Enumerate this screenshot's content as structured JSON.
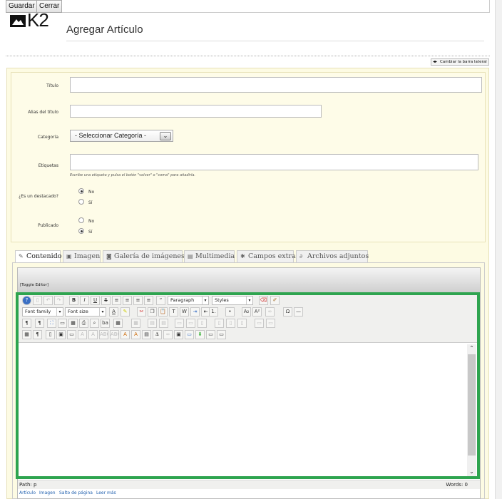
{
  "toolbar": {
    "save_label": "Guardar",
    "close_label": "Cerrar"
  },
  "header": {
    "logo_text": "K2",
    "title": "Agregar Artículo",
    "sidebar_toggle_label": "Cambiar la barra lateral"
  },
  "form": {
    "title_label": "Título",
    "alias_label": "Alias del título",
    "category_label": "Categoría",
    "category_value": "- Seleccionar Categoría -",
    "tags_label": "Etiquetas",
    "tags_hint": "Escribe una etiqueta y pulsa el botón \"volver\" o \"coma\" para añadirla.",
    "featured_label": "¿Es un destacado?",
    "published_label": "Publicado",
    "no_label": "No",
    "yes_label": "Sí",
    "featured_value": "No",
    "published_value": "Sí"
  },
  "tabs": [
    {
      "label": "Contenido",
      "icon": "pencil-icon",
      "active": true
    },
    {
      "label": "Imagen",
      "icon": "image-icon"
    },
    {
      "label": "Galería de imágenes",
      "icon": "camera-icon"
    },
    {
      "label": "Multimedia",
      "icon": "film-icon"
    },
    {
      "label": "Campos extra",
      "icon": "wrench-icon"
    },
    {
      "label": "Archivos adjuntos",
      "icon": "paperclip-icon"
    }
  ],
  "editor": {
    "toggle_label": "[Toggle Editor]",
    "format_select": "Paragraph",
    "styles_select": "Styles",
    "font_family_select": "Font family",
    "font_size_select": "Font size",
    "path_text": "Path:  p",
    "words_text": "Words: 0",
    "bottom_buttons": [
      "Artículo",
      "Imagen",
      "Salto de página",
      "Leer más"
    ]
  },
  "colors": {
    "panel_bg": "#fdfbe3",
    "highlight": "#2ea44f",
    "link": "#1f5fae"
  }
}
